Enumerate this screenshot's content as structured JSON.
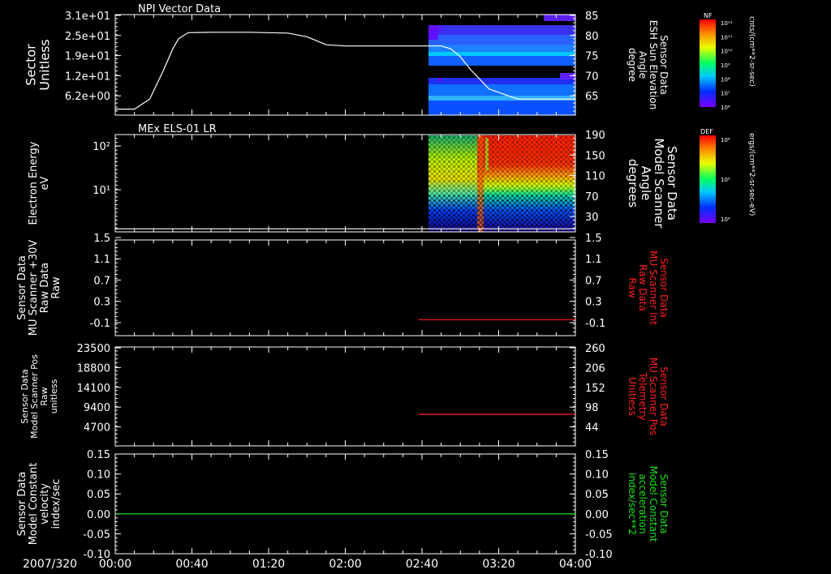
{
  "colors": {
    "axis": "#ffffff",
    "red_trace": "#ff2020",
    "green_trace": "#19e619",
    "white_trace": "#ffffff"
  },
  "time_axis": {
    "date_label": "2007/320",
    "ticks": [
      "00:00",
      "00:40",
      "01:20",
      "02:00",
      "02:40",
      "03:20",
      "04:00"
    ],
    "start_min": 0,
    "end_min": 240
  },
  "chart_data": [
    {
      "id": "panel1",
      "type": "line",
      "title": "NPI Vector Data",
      "ylabel_left": [
        "Sector",
        "Unitless"
      ],
      "left_ticks": [
        "3.1e+01",
        "2.5e+01",
        "1.9e+01",
        "1.2e+01",
        "6.2e+00"
      ],
      "ylabel_right": [
        "Sensor Data",
        "ESH Sun Elevation",
        "Angle",
        "degree"
      ],
      "right_ticks": [
        "85",
        "80",
        "75",
        "70",
        "65"
      ],
      "ylim_right": [
        60,
        85
      ],
      "series": [
        {
          "color": "white",
          "x": [
            0,
            10,
            18,
            25,
            30,
            33,
            38,
            50,
            70,
            90,
            100,
            110,
            120,
            140,
            170,
            175,
            180,
            185,
            195,
            210,
            240
          ],
          "y": [
            61.5,
            61.5,
            64.0,
            71.0,
            76.5,
            79.0,
            80.5,
            80.6,
            80.6,
            80.4,
            79.5,
            77.5,
            77.2,
            77.2,
            77.2,
            76.5,
            74.5,
            71.5,
            66.5,
            64.0,
            64.0
          ]
        }
      ],
      "spectrogram": {
        "x_start_min": 162,
        "x_end_min": 240
      },
      "colorbar": {
        "label": "NF",
        "units": "cnts/(cm**2-sr-sec)",
        "ticks": [
          "10¹²",
          "10¹¹",
          "10¹⁰",
          "10⁹",
          "10⁸",
          "10⁷",
          "10⁶"
        ]
      }
    },
    {
      "id": "panel2",
      "type": "heatmap",
      "title": "MEx ELS-01 LR",
      "ylabel_left": [
        "Electron Energy",
        "eV"
      ],
      "left_ticks": [
        "10²",
        "10¹"
      ],
      "ylabel_right": [
        "Sensor Data",
        "Model Scanner",
        "Angle",
        "degrees"
      ],
      "right_ticks": [
        "190",
        "150",
        "110",
        "70",
        "30"
      ],
      "ylim_right": [
        0,
        190
      ],
      "series": [
        {
          "color": "white",
          "x": [
            0,
            240
          ],
          "y": [
            6,
            6
          ]
        }
      ],
      "spectrogram": {
        "x_start_min": 162,
        "x_end_min": 240
      },
      "colorbar": {
        "label": "DEF",
        "units": "ergs/(cm**2-sr-sec-eV)",
        "ticks": [
          "10⁶",
          "10⁵",
          "10⁴"
        ]
      }
    },
    {
      "id": "panel3",
      "type": "line",
      "ylabel_left": [
        "Sensor Data",
        "MU Scanner +30V",
        "Raw Data",
        "Raw"
      ],
      "left_ticks": [
        "1.5",
        "1.1",
        "0.7",
        "0.3",
        "-0.1"
      ],
      "ylabel_right": [
        "Sensor Data",
        "MU Scanner Int",
        "Raw Data",
        "Raw"
      ],
      "right_ticks": [
        "1.5",
        "1.1",
        "0.7",
        "0.3",
        "-0.1"
      ],
      "ylim_right": [
        -0.3,
        1.5
      ],
      "series": [
        {
          "color": "red",
          "x": [
            158,
            240
          ],
          "y": [
            0.0,
            0.0
          ]
        }
      ]
    },
    {
      "id": "panel4",
      "type": "line",
      "ylabel_left": [
        "Sensor Data",
        "Model Scanner Pos",
        "Raw",
        "unitless"
      ],
      "left_ticks": [
        "23500",
        "18800",
        "14100",
        "9400",
        "4700"
      ],
      "ylabel_right": [
        "Sensor Data",
        "MU Scanner Pos",
        "Telemetry",
        "Unitless"
      ],
      "right_ticks": [
        "260",
        "206",
        "152",
        "98",
        "44"
      ],
      "ylim_right": [
        10,
        260
      ],
      "series": [
        {
          "color": "red",
          "x": [
            158,
            240
          ],
          "y": [
            90,
            90
          ]
        }
      ]
    },
    {
      "id": "panel5",
      "type": "line",
      "ylabel_left": [
        "Sensor Data",
        "Model Constant",
        "velocity",
        "index/sec"
      ],
      "left_ticks": [
        "0.15",
        "0.10",
        "0.05",
        "0.00",
        "-0.05",
        "-0.10"
      ],
      "ylabel_right": [
        "Sensor Data",
        "Model Constant",
        "acceleration",
        "index/sec**2"
      ],
      "right_ticks": [
        "0.15",
        "0.10",
        "0.05",
        "0.00",
        "-0.05",
        "-0.10"
      ],
      "ylim_right": [
        -0.1,
        0.15
      ],
      "series": [
        {
          "color": "green",
          "x": [
            0,
            240
          ],
          "y": [
            0.0,
            0.0
          ]
        }
      ]
    }
  ]
}
